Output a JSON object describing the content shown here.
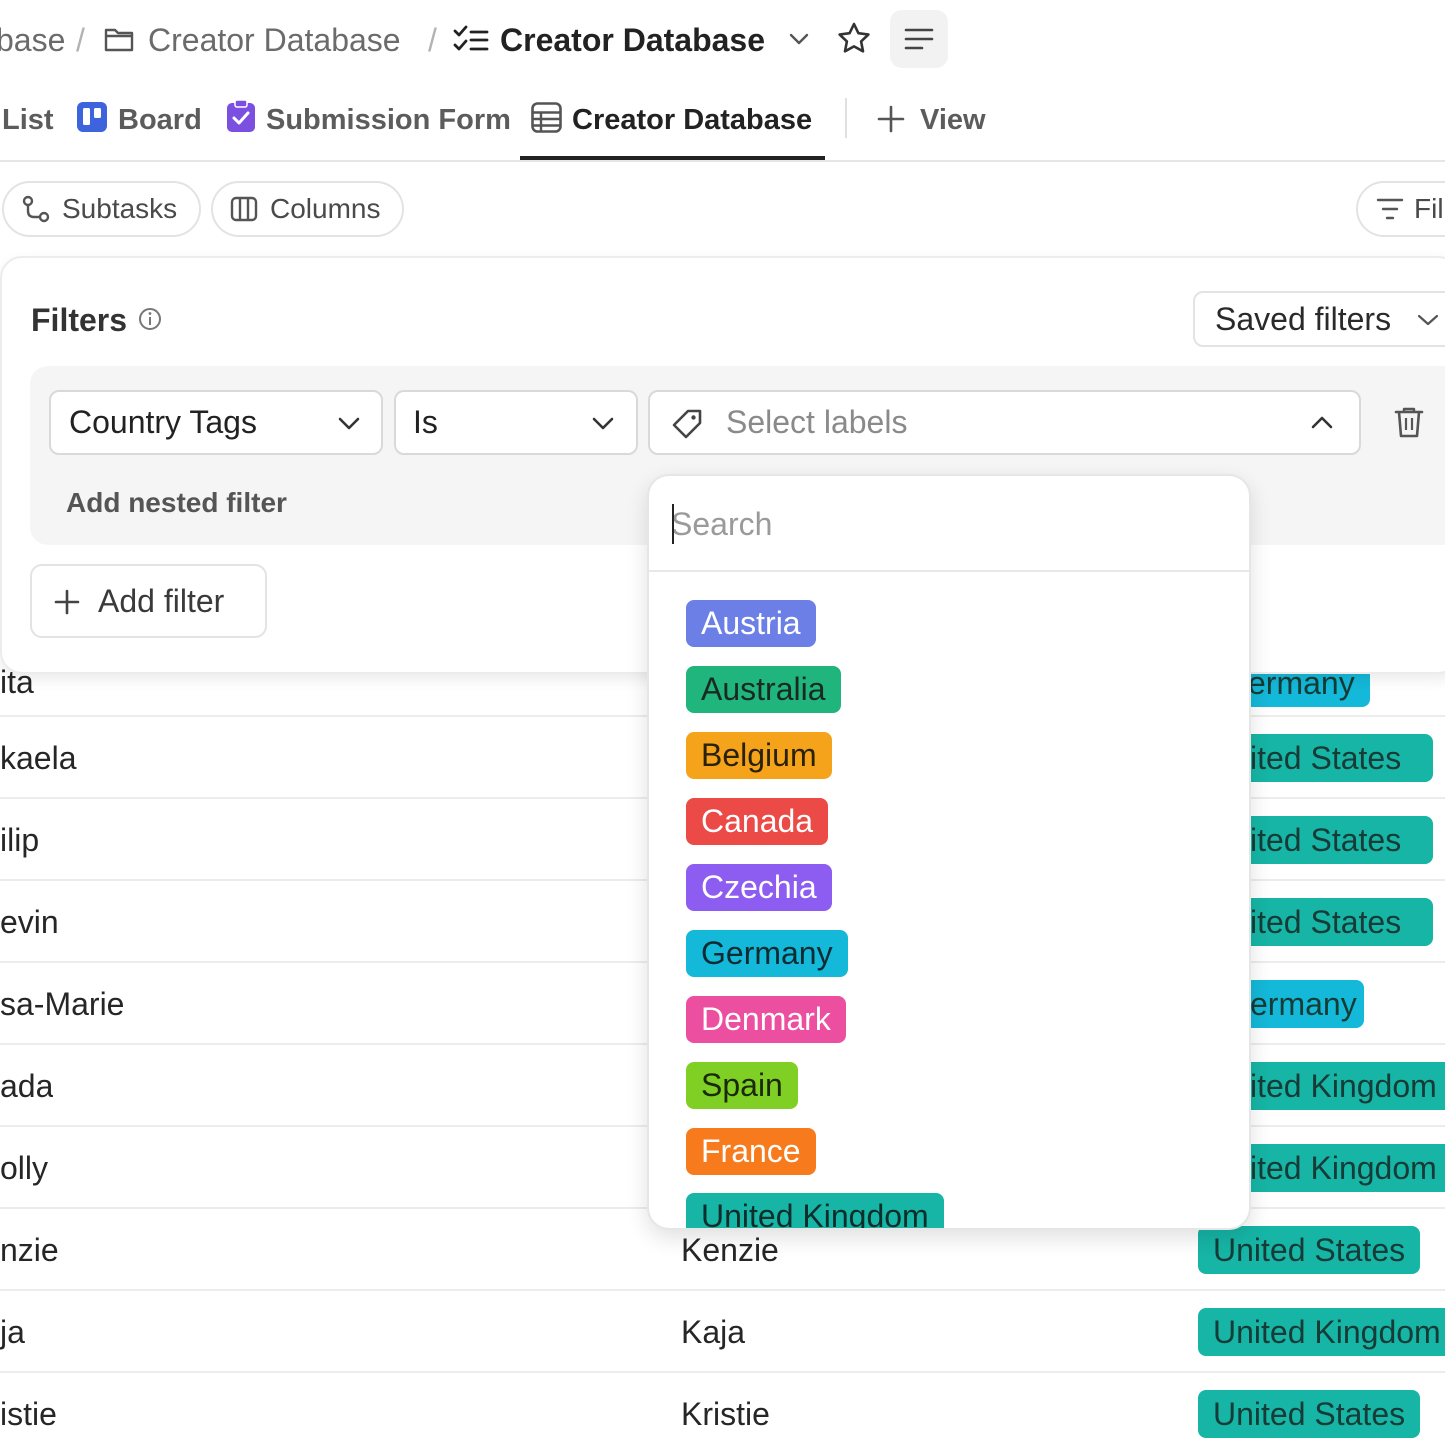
{
  "breadcrumb": {
    "prev_partial": "base",
    "folder": "Creator Database",
    "current": "Creator Database"
  },
  "tabs": [
    {
      "label": "List"
    },
    {
      "label": "Board"
    },
    {
      "label": "Submission Form"
    },
    {
      "label": "Creator Database"
    },
    {
      "label": "View"
    }
  ],
  "toolbar": {
    "subtasks": "Subtasks",
    "columns": "Columns",
    "filter_partial": "Fil"
  },
  "filters": {
    "title": "Filters",
    "saved_filters": "Saved filters",
    "field": "Country Tags",
    "operator": "Is",
    "value_placeholder": "Select labels",
    "add_nested": "Add nested filter",
    "add_filter": "Add filter"
  },
  "dropdown": {
    "search_placeholder": "Search",
    "options": [
      {
        "label": "Austria",
        "color": "#6b7fe6",
        "text": "#ffffff"
      },
      {
        "label": "Australia",
        "color": "#1fb57c",
        "text": "#1a2a22"
      },
      {
        "label": "Belgium",
        "color": "#f6a31c",
        "text": "#2a2208"
      },
      {
        "label": "Canada",
        "color": "#ec4a47",
        "text": "#ffffff"
      },
      {
        "label": "Czechia",
        "color": "#8d5cf0",
        "text": "#ffffff"
      },
      {
        "label": "Germany",
        "color": "#14b8d8",
        "text": "#0e2a33"
      },
      {
        "label": "Denmark",
        "color": "#ec4f9f",
        "text": "#ffffff"
      },
      {
        "label": "Spain",
        "color": "#7fcf24",
        "text": "#1a2a08"
      },
      {
        "label": "France",
        "color": "#f77a1c",
        "text": "#ffffff"
      },
      {
        "label": "United Kingdom",
        "color": "#16b5a6",
        "text": "#0f2d2a"
      }
    ]
  },
  "table": {
    "rows": [
      {
        "name": "ita",
        "name2": "",
        "tag": "ermany",
        "tag_color": "#14b8d8"
      },
      {
        "name": "kaela",
        "name2": "",
        "tag": "ited States",
        "tag_color": "#16b5a6"
      },
      {
        "name": "ilip",
        "name2": "",
        "tag": "ited States",
        "tag_color": "#16b5a6"
      },
      {
        "name": "evin",
        "name2": "",
        "tag": "ited States",
        "tag_color": "#16b5a6"
      },
      {
        "name": "sa-Marie",
        "name2": "",
        "tag": "ermany",
        "tag_color": "#14b8d8"
      },
      {
        "name": "ada",
        "name2": "",
        "tag": "ited Kingdom",
        "tag_color": "#16b5a6"
      },
      {
        "name": "olly",
        "name2": "",
        "tag": "ited Kingdom",
        "tag_color": "#16b5a6"
      },
      {
        "name": "nzie",
        "name2": "Kenzie",
        "tag": "United States",
        "tag_color": "#16b5a6"
      },
      {
        "name": "ja",
        "name2": "Kaja",
        "tag": "United Kingdom",
        "tag_color": "#16b5a6"
      },
      {
        "name": "istie",
        "name2": "Kristie",
        "tag": "United States",
        "tag_color": "#16b5a6"
      }
    ]
  },
  "colors": {
    "board_icon": "#3d63dd",
    "form_icon": "#7b4fe0",
    "accent": "#16b5a6"
  }
}
